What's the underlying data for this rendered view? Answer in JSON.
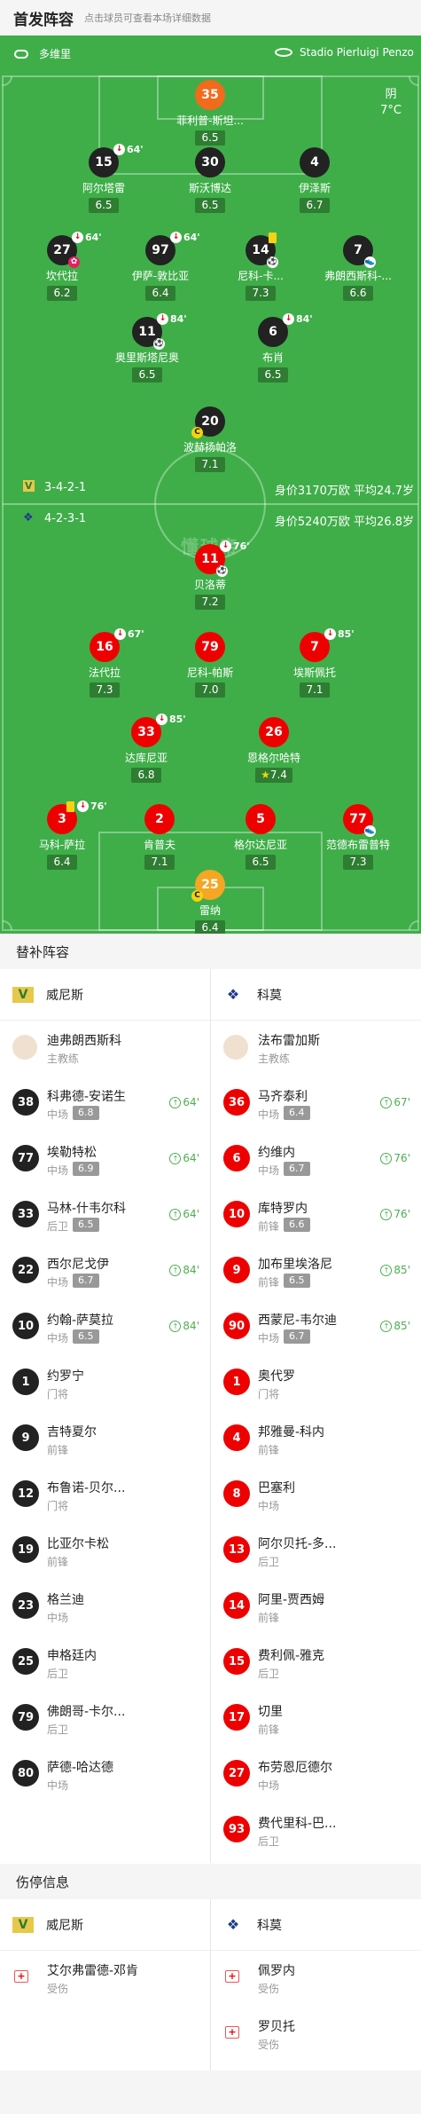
{
  "header": {
    "title": "首发阵容",
    "subtitle": "点击球员可查看本场详细数据"
  },
  "pitch": {
    "home_team": "多维里",
    "venue": "Stadio Pierluigi Penzo",
    "weather": "阴",
    "temperature": "7°C",
    "watermark": "懂球帝",
    "home_formation": "3-4-2-1",
    "home_value": "身价3170万欧 平均24.7岁",
    "away_formation": "4-2-3-1",
    "away_value": "身价5240万欧 平均26.8岁",
    "players": [
      {
        "num": "35",
        "name": "菲利普-斯坦...",
        "rating": "6.5"
      },
      {
        "num": "15",
        "name": "阿尔塔雷",
        "rating": "6.5",
        "sub": "64'"
      },
      {
        "num": "30",
        "name": "斯沃博达",
        "rating": "6.5"
      },
      {
        "num": "4",
        "name": "伊泽斯",
        "rating": "6.7"
      },
      {
        "num": "27",
        "name": "坎代拉",
        "rating": "6.2",
        "sub": "64'"
      },
      {
        "num": "97",
        "name": "伊萨-敦比亚",
        "rating": "6.4",
        "sub": "64'"
      },
      {
        "num": "14",
        "name": "尼科-卡...",
        "rating": "7.3"
      },
      {
        "num": "7",
        "name": "弗朗西斯科-...",
        "rating": "6.6"
      },
      {
        "num": "11",
        "name": "奥里斯塔尼奥",
        "rating": "6.5",
        "sub": "84'"
      },
      {
        "num": "6",
        "name": "布肖",
        "rating": "6.5",
        "sub": "84'"
      },
      {
        "num": "20",
        "name": "波赫扬帕洛",
        "rating": "7.1"
      },
      {
        "num": "11",
        "name": "贝洛蒂",
        "rating": "7.2",
        "sub": "76'"
      },
      {
        "num": "16",
        "name": "法代拉",
        "rating": "7.3",
        "sub": "67'"
      },
      {
        "num": "79",
        "name": "尼科-帕斯",
        "rating": "7.0"
      },
      {
        "num": "7",
        "name": "埃斯佩托",
        "rating": "7.1",
        "sub": "85'"
      },
      {
        "num": "33",
        "name": "达库尼亚",
        "rating": "6.8",
        "sub": "85'"
      },
      {
        "num": "26",
        "name": "恩格尔哈特",
        "rating": "7.4"
      },
      {
        "num": "3",
        "name": "马科-萨拉",
        "rating": "6.4",
        "sub": "76'"
      },
      {
        "num": "2",
        "name": "肯普夫",
        "rating": "7.1"
      },
      {
        "num": "5",
        "name": "格尔达尼亚",
        "rating": "6.5"
      },
      {
        "num": "77",
        "name": "范德布雷普特",
        "rating": "7.3"
      },
      {
        "num": "25",
        "name": "雷纳",
        "rating": "6.4"
      }
    ]
  },
  "subs": {
    "title": "替补阵容",
    "home_team": "威尼斯",
    "away_team": "科莫",
    "home_coach": {
      "name": "迪弗朗西斯科",
      "role": "主教练"
    },
    "away_coach": {
      "name": "法布雷加斯",
      "role": "主教练"
    },
    "home": [
      {
        "num": "38",
        "name": "科弗德-安诺生",
        "pos": "中场",
        "rating": "6.8",
        "min": "64'"
      },
      {
        "num": "77",
        "name": "埃勒特松",
        "pos": "中场",
        "rating": "6.9",
        "min": "64'"
      },
      {
        "num": "33",
        "name": "马林-什韦尔科",
        "pos": "后卫",
        "rating": "6.5",
        "min": "64'"
      },
      {
        "num": "22",
        "name": "西尔尼戈伊",
        "pos": "中场",
        "rating": "6.7",
        "min": "84'"
      },
      {
        "num": "10",
        "name": "约翰-萨莫拉",
        "pos": "中场",
        "rating": "6.5",
        "min": "84'"
      },
      {
        "num": "1",
        "name": "约罗宁",
        "pos": "门将"
      },
      {
        "num": "9",
        "name": "吉特夏尔",
        "pos": "前锋"
      },
      {
        "num": "12",
        "name": "布鲁诺-贝尔...",
        "pos": "门将"
      },
      {
        "num": "19",
        "name": "比亚尔卡松",
        "pos": "前锋"
      },
      {
        "num": "23",
        "name": "格兰迪",
        "pos": "中场"
      },
      {
        "num": "25",
        "name": "申格廷内",
        "pos": "后卫"
      },
      {
        "num": "79",
        "name": "佛朗哥-卡尔...",
        "pos": "后卫"
      },
      {
        "num": "80",
        "name": "萨德-哈达德",
        "pos": "中场"
      }
    ],
    "away": [
      {
        "num": "36",
        "name": "马齐泰利",
        "pos": "中场",
        "rating": "6.4",
        "min": "67'"
      },
      {
        "num": "6",
        "name": "约维内",
        "pos": "中场",
        "rating": "6.7",
        "min": "76'"
      },
      {
        "num": "10",
        "name": "库特罗内",
        "pos": "前锋",
        "rating": "6.6",
        "min": "76'"
      },
      {
        "num": "9",
        "name": "加布里埃洛尼",
        "pos": "前锋",
        "rating": "6.5",
        "min": "85'"
      },
      {
        "num": "90",
        "name": "西蒙尼-韦尔迪",
        "pos": "中场",
        "rating": "6.7",
        "min": "85'"
      },
      {
        "num": "1",
        "name": "奥代罗",
        "pos": "门将"
      },
      {
        "num": "4",
        "name": "邦雅曼-科内",
        "pos": "前锋"
      },
      {
        "num": "8",
        "name": "巴塞利",
        "pos": "中场"
      },
      {
        "num": "13",
        "name": "阿尔贝托-多...",
        "pos": "后卫"
      },
      {
        "num": "14",
        "name": "阿里-贾西姆",
        "pos": "前锋"
      },
      {
        "num": "15",
        "name": "费利佩-雅克",
        "pos": "后卫"
      },
      {
        "num": "17",
        "name": "切里",
        "pos": "前锋"
      },
      {
        "num": "27",
        "name": "布劳恩厄德尔",
        "pos": "中场"
      },
      {
        "num": "93",
        "name": "费代里科-巴...",
        "pos": "后卫"
      }
    ]
  },
  "injuries": {
    "title": "伤停信息",
    "home_team": "威尼斯",
    "away_team": "科莫",
    "home": [
      {
        "name": "艾尔弗雷德-邓肯",
        "status": "受伤"
      }
    ],
    "away": [
      {
        "name": "佩罗内",
        "status": "受伤"
      },
      {
        "name": "罗贝托",
        "status": "受伤"
      }
    ]
  },
  "colors": {
    "pitch": "#3fae49",
    "home_kit": "#222222",
    "away_kit": "#ee0000",
    "rating_bg": "#2e7d32",
    "sub_in": "#4caf50"
  }
}
